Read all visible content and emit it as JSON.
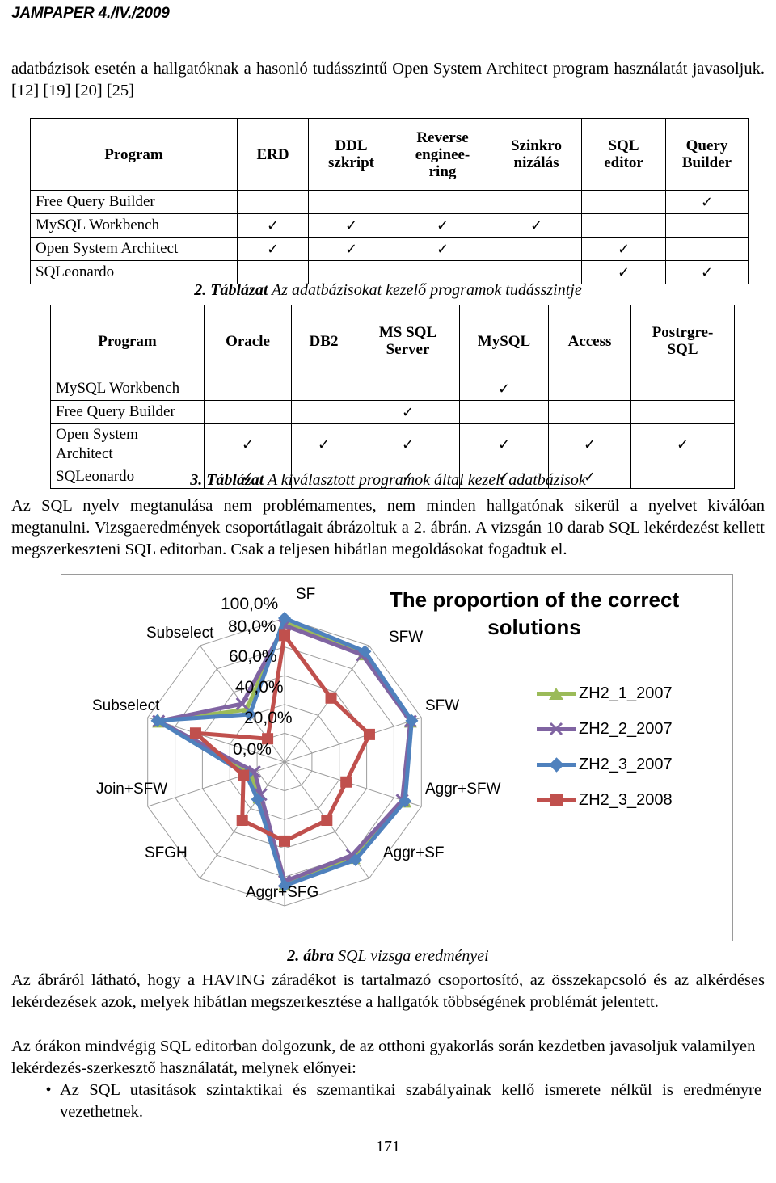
{
  "header": {
    "running_head": "JAMPAPER 4./IV./2009"
  },
  "intro": {
    "paragraph": "adatbázisok esetén a hallgatóknak a hasonló tudásszintű Open System Architect program használatát javasoljuk. [12] [19] [20] [25]"
  },
  "table2": {
    "columns": [
      "Program",
      "ERD",
      "DDL szkript",
      "Reverse enginee-ring",
      "Szinkro nizálás",
      "SQL editor",
      "Query Builder"
    ],
    "column_lines": [
      [
        "Program"
      ],
      [
        "ERD"
      ],
      [
        "DDL",
        "szkript"
      ],
      [
        "Reverse",
        "enginee-",
        "ring"
      ],
      [
        "Szinkro",
        "nizálás"
      ],
      [
        "SQL",
        "editor"
      ],
      [
        "Query",
        "Builder"
      ]
    ],
    "rows": [
      {
        "name": "Free Query Builder",
        "marks": [
          false,
          false,
          false,
          false,
          false,
          true
        ]
      },
      {
        "name": "MySQL Workbench",
        "marks": [
          true,
          true,
          true,
          true,
          false,
          false
        ]
      },
      {
        "name": "Open System Architect",
        "marks": [
          true,
          true,
          true,
          false,
          true,
          false
        ]
      },
      {
        "name": "SQLeonardo",
        "marks": [
          false,
          false,
          false,
          false,
          true,
          true
        ]
      }
    ],
    "check_glyph": "✓",
    "caption_label": "2. Táblázat",
    "caption_text": "Az adatbázisokat kezelő programok tudásszintje"
  },
  "table3": {
    "columns": [
      "Program",
      "Oracle",
      "DB2",
      "MS SQL Server",
      "MySQL",
      "Access",
      "Postrgre-SQL"
    ],
    "column_lines": [
      [
        "Program"
      ],
      [
        "Oracle"
      ],
      [
        "DB2"
      ],
      [
        "MS SQL",
        "Server"
      ],
      [
        "MySQL"
      ],
      [
        "Access"
      ],
      [
        "Postrgre-",
        "SQL"
      ]
    ],
    "rows": [
      {
        "name": "MySQL Workbench",
        "marks": [
          false,
          false,
          false,
          true,
          false,
          false
        ]
      },
      {
        "name": "Free Query Builder",
        "marks": [
          false,
          false,
          true,
          false,
          false,
          false
        ]
      },
      {
        "name": "Open System Architect",
        "name_lines": [
          "Open System",
          "Architect"
        ],
        "marks": [
          true,
          true,
          true,
          true,
          true,
          true
        ]
      },
      {
        "name": "SQLeonardo",
        "marks": [
          true,
          false,
          true,
          true,
          true,
          false
        ]
      }
    ],
    "check_glyph": "✓",
    "caption_label": "3. Táblázat",
    "caption_text": "A kiválasztott programok által kezelt adatbázisok"
  },
  "body": {
    "para1": "Az SQL nyelv megtanulása nem problémamentes, nem minden hallgatónak sikerül a nyelvet kiválóan megtanulni. Vizsgaeredmények csoportátlagait ábrázoltuk a 2. ábrán. A vizsgán 10 darab SQL lekérdezést kellett megszerkeszteni SQL editorban. Csak a teljesen hibátlan megoldásokat fogadtuk el.",
    "figure_caption_label": "2. ábra",
    "figure_caption_text": "SQL vizsga eredményei",
    "para2": "Az ábráról látható, hogy a HAVING záradékot is tartalmazó csoportosító, az összekapcsoló és az alkérdéses lekérdezések azok, melyek hibátlan megszerkesztése a hallgatók többségének problémát jelentett.",
    "para3": "Az órákon mindvégig SQL editorban dolgozunk, de az otthoni gyakorlás során kezdetben javasoljuk valamilyen lekérdezés-szerkesztő használatát, melynek előnyei:",
    "bullet1": "Az SQL utasítások szintaktikai és szemantikai szabályainak kellő ismerete nélkül is eredményre vezethetnek.",
    "bullet_glyph": "•",
    "page_number": "171"
  },
  "chart_data": {
    "type": "radar",
    "title": "The proportion of the correct solutions",
    "categories": [
      "SF",
      "SFW",
      "SFW",
      "Aggr+SFW",
      "Aggr+SF",
      "Aggr+SFG",
      "SFGH",
      "Join+SFW",
      "Subselect",
      "Subselect"
    ],
    "tick_labels": [
      "0,0%",
      "20,0%",
      "40,0%",
      "60,0%",
      "80,0%",
      "100,0%"
    ],
    "ylim": [
      0,
      100
    ],
    "tick_step": 20,
    "grid": true,
    "legend_position": "right",
    "series": [
      {
        "name": "ZH2_1_2007",
        "color": "#9BBB59",
        "marker": "triangle",
        "values": [
          97,
          93,
          92,
          88,
          82,
          85,
          30,
          25,
          92,
          45
        ]
      },
      {
        "name": "ZH2_2_2007",
        "color": "#8064A2",
        "marker": "x",
        "values": [
          95,
          92,
          92,
          86,
          80,
          83,
          28,
          22,
          92,
          50
        ]
      },
      {
        "name": "ZH2_3_2007",
        "color": "#4F81BD",
        "marker": "diamond",
        "values": [
          100,
          95,
          93,
          88,
          84,
          86,
          32,
          28,
          93,
          41
        ]
      },
      {
        "name": "ZH2_3_2008",
        "color": "#C0504D",
        "marker": "square",
        "values": [
          88,
          55,
          62,
          45,
          50,
          55,
          50,
          30,
          65,
          20
        ]
      }
    ]
  }
}
